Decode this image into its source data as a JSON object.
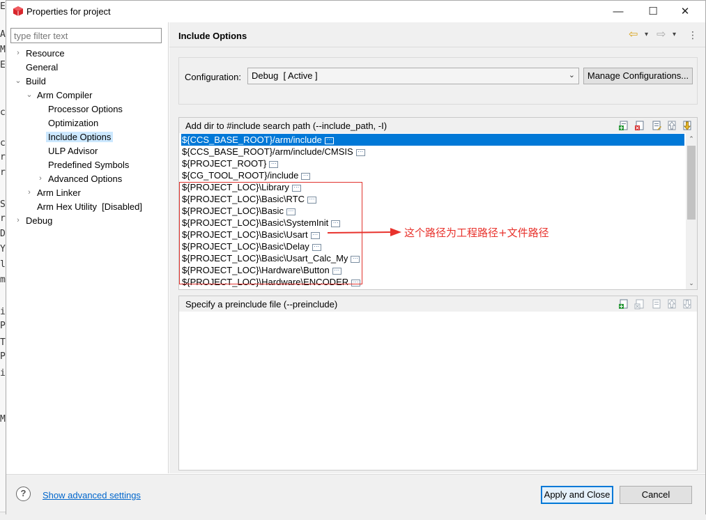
{
  "background": {
    "chars": [
      "E",
      "A",
      "M",
      "E",
      "c",
      "c",
      "r",
      "r",
      "S",
      "r",
      "D",
      "Y",
      "l",
      "m",
      "i",
      "P",
      "T",
      "P",
      "i",
      "Me"
    ]
  },
  "window": {
    "title": "Properties for project",
    "controls": {
      "minimize": "—",
      "maximize": "☐",
      "close": "✕"
    }
  },
  "sidebar": {
    "filter_placeholder": "type filter text",
    "items": [
      {
        "label": "Resource",
        "arrow": "›"
      },
      {
        "label": "General",
        "arrow": ""
      },
      {
        "label": "Build",
        "arrow": "⌄"
      },
      {
        "label": "Arm Compiler",
        "arrow": "⌄"
      },
      {
        "label": "Processor Options",
        "arrow": ""
      },
      {
        "label": "Optimization",
        "arrow": ""
      },
      {
        "label": "Include Options",
        "arrow": "",
        "selected": true
      },
      {
        "label": "ULP Advisor",
        "arrow": ""
      },
      {
        "label": "Predefined Symbols",
        "arrow": ""
      },
      {
        "label": "Advanced Options",
        "arrow": "›"
      },
      {
        "label": "Arm Linker",
        "arrow": "›"
      },
      {
        "label": "Arm Hex Utility  [Disabled]",
        "arrow": ""
      },
      {
        "label": "Debug",
        "arrow": "›"
      }
    ]
  },
  "main": {
    "page_title": "Include Options",
    "nav": {
      "back": "⇦",
      "forward": "⇨",
      "menu": "⋮",
      "dropdown": "▾"
    },
    "configuration": {
      "label": "Configuration:",
      "value": "Debug  [ Active ]",
      "manage_label": "Manage Configurations..."
    },
    "include_paths": {
      "title": "Add dir to #include search path (--include_path, -I)",
      "items": [
        "${CCS_BASE_ROOT}/arm/include",
        "${CCS_BASE_ROOT}/arm/include/CMSIS",
        "${PROJECT_ROOT}",
        "${CG_TOOL_ROOT}/include",
        "${PROJECT_LOC}\\Library",
        "${PROJECT_LOC}\\Basic\\RTC",
        "${PROJECT_LOC}\\Basic",
        "${PROJECT_LOC}\\Basic\\SystemInit",
        "${PROJECT_LOC}\\Basic\\Usart",
        "${PROJECT_LOC}\\Basic\\Delay",
        "${PROJECT_LOC}\\Basic\\Usart_Calc_My",
        "${PROJECT_LOC}\\Hardware\\Button",
        "${PROJECT_LOC}\\Hardware\\ENCODER"
      ],
      "selected_index": 0
    },
    "preinclude": {
      "title": "Specify a preinclude file (--preinclude)",
      "items": []
    },
    "annotation": "这个路径为工程路径+文件路径"
  },
  "footer": {
    "help": "?",
    "advanced_link": "Show advanced settings",
    "apply_label": "Apply and Close",
    "cancel_label": "Cancel"
  },
  "colors": {
    "selection": "#0078d7",
    "tree_selection": "#cce8ff",
    "annotation_red": "#e8322c",
    "link": "#0066cc"
  }
}
